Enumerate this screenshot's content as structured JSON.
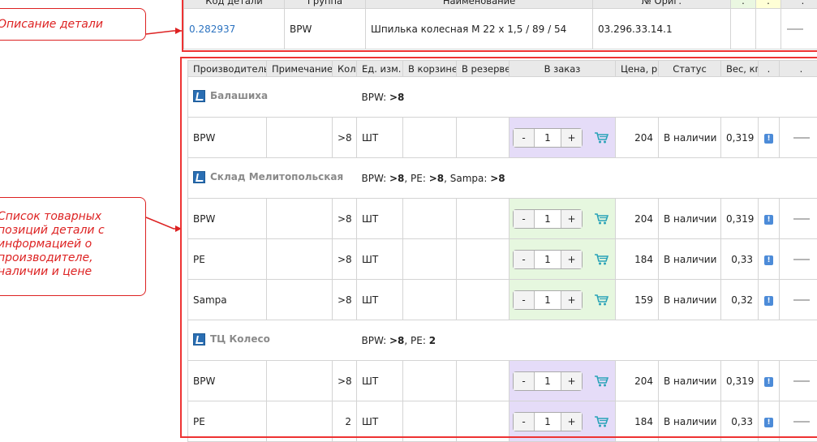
{
  "callouts": {
    "description": "Описание детали",
    "list": "Список товарных позиций детали с информацией о производителе, наличии и цене"
  },
  "part_table": {
    "headers": [
      "Код детали",
      "Группа",
      "Наименование",
      "№ Ориг.",
      ".",
      ".",
      "."
    ],
    "row": {
      "code": "0.282937",
      "group": "BPW",
      "name": "Шпилька колесная М 22 х 1,5 / 89 / 54",
      "orig": "03.296.33.14.1"
    }
  },
  "offers_table": {
    "headers": [
      "Производитель",
      "Примечание",
      "Кол.",
      "Ед. изм.",
      "В корзине",
      "В резерве",
      "В заказ",
      "Цена, р",
      "Статус",
      "Вес, кг",
      ".",
      "."
    ],
    "groups": [
      {
        "name": "Балашиха",
        "stock_parts": [
          {
            "label": "BPW: ",
            "value": ">8"
          }
        ],
        "rows": [
          {
            "maker": "BPW",
            "note": "",
            "qty": ">8",
            "unit": "ШТ",
            "in_cart": "",
            "reserved": "",
            "order_qty": "1",
            "price": "204",
            "status": "В наличии",
            "weight": "0,319",
            "highlight": "purple"
          }
        ]
      },
      {
        "name": "Склад Мелитопольская",
        "stock_parts": [
          {
            "label": "BPW: ",
            "value": ">8"
          },
          {
            "label": ", PE: ",
            "value": ">8"
          },
          {
            "label": ", Sampa: ",
            "value": ">8"
          }
        ],
        "rows": [
          {
            "maker": "BPW",
            "note": "",
            "qty": ">8",
            "unit": "ШТ",
            "in_cart": "",
            "reserved": "",
            "order_qty": "1",
            "price": "204",
            "status": "В наличии",
            "weight": "0,319",
            "highlight": "green"
          },
          {
            "maker": "PE",
            "note": "",
            "qty": ">8",
            "unit": "ШТ",
            "in_cart": "",
            "reserved": "",
            "order_qty": "1",
            "price": "184",
            "status": "В наличии",
            "weight": "0,33",
            "highlight": "green"
          },
          {
            "maker": "Sampa",
            "note": "",
            "qty": ">8",
            "unit": "ШТ",
            "in_cart": "",
            "reserved": "",
            "order_qty": "1",
            "price": "159",
            "status": "В наличии",
            "weight": "0,32",
            "highlight": "green"
          }
        ]
      },
      {
        "name": "ТЦ Колесо",
        "stock_parts": [
          {
            "label": "BPW: ",
            "value": ">8"
          },
          {
            "label": ", PE: ",
            "value": "2"
          }
        ],
        "rows": [
          {
            "maker": "BPW",
            "note": "",
            "qty": ">8",
            "unit": "ШТ",
            "in_cart": "",
            "reserved": "",
            "order_qty": "1",
            "price": "204",
            "status": "В наличии",
            "weight": "0,319",
            "highlight": "purple"
          },
          {
            "maker": "PE",
            "note": "",
            "qty": "2",
            "unit": "ШТ",
            "in_cart": "",
            "reserved": "",
            "order_qty": "1",
            "price": "184",
            "status": "В наличии",
            "weight": "0,33",
            "highlight": "purple"
          }
        ]
      }
    ],
    "stepper": {
      "minus": "-",
      "plus": "+"
    },
    "info_glyph": "!"
  },
  "colors": {
    "annotation_red": "#dd2222",
    "link_blue": "#2c73c0",
    "order_purple": "#e5dcf8",
    "order_green": "#e6f7df",
    "cart_teal": "#2aa3b8",
    "header_grey": "#e9e9e9"
  },
  "icons": {
    "warehouse": "warehouse-icon",
    "cart": "cart-icon",
    "info": "info-icon",
    "thumbnail": "product-thumbnail"
  }
}
